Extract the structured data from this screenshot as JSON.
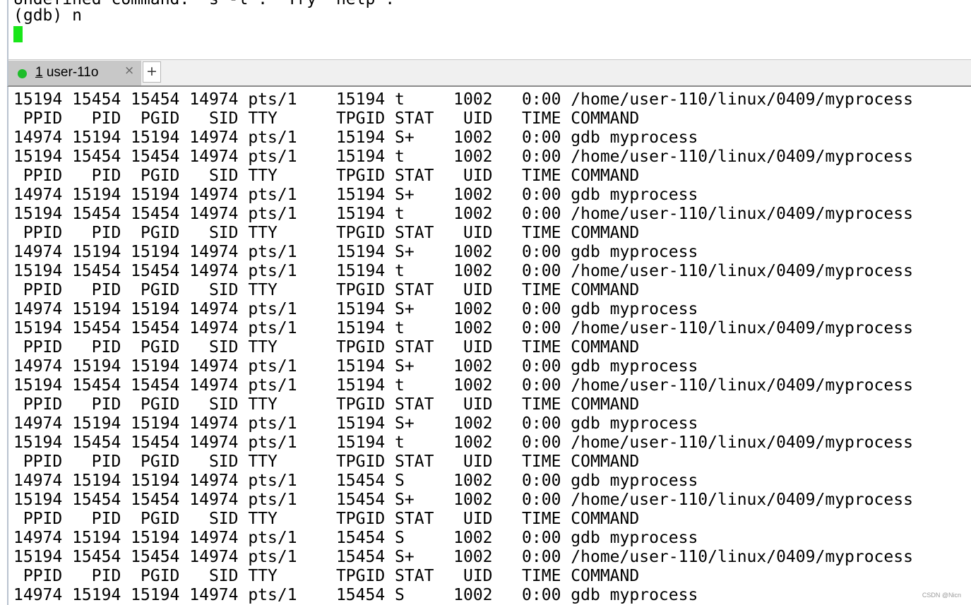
{
  "top_pane": {
    "lines": [
      "Undefined command: \"s -l\".  Try \"help\".",
      "(gdb) n"
    ]
  },
  "tab_bar": {
    "tab": {
      "index": "1",
      "title": " user-11o",
      "status_color": "#1ebd2a"
    },
    "close_glyph": "×",
    "new_tab_glyph": "+"
  },
  "output_lines": [
    "15194 15454 15454 14974 pts/1    15194 t     1002   0:00 /home/user-110/linux/0409/myprocess",
    " PPID   PID  PGID   SID TTY      TPGID STAT   UID   TIME COMMAND",
    "14974 15194 15194 14974 pts/1    15194 S+    1002   0:00 gdb myprocess",
    "15194 15454 15454 14974 pts/1    15194 t     1002   0:00 /home/user-110/linux/0409/myprocess",
    " PPID   PID  PGID   SID TTY      TPGID STAT   UID   TIME COMMAND",
    "14974 15194 15194 14974 pts/1    15194 S+    1002   0:00 gdb myprocess",
    "15194 15454 15454 14974 pts/1    15194 t     1002   0:00 /home/user-110/linux/0409/myprocess",
    " PPID   PID  PGID   SID TTY      TPGID STAT   UID   TIME COMMAND",
    "14974 15194 15194 14974 pts/1    15194 S+    1002   0:00 gdb myprocess",
    "15194 15454 15454 14974 pts/1    15194 t     1002   0:00 /home/user-110/linux/0409/myprocess",
    " PPID   PID  PGID   SID TTY      TPGID STAT   UID   TIME COMMAND",
    "14974 15194 15194 14974 pts/1    15194 S+    1002   0:00 gdb myprocess",
    "15194 15454 15454 14974 pts/1    15194 t     1002   0:00 /home/user-110/linux/0409/myprocess",
    " PPID   PID  PGID   SID TTY      TPGID STAT   UID   TIME COMMAND",
    "14974 15194 15194 14974 pts/1    15194 S+    1002   0:00 gdb myprocess",
    "15194 15454 15454 14974 pts/1    15194 t     1002   0:00 /home/user-110/linux/0409/myprocess",
    " PPID   PID  PGID   SID TTY      TPGID STAT   UID   TIME COMMAND",
    "14974 15194 15194 14974 pts/1    15194 S+    1002   0:00 gdb myprocess",
    "15194 15454 15454 14974 pts/1    15194 t     1002   0:00 /home/user-110/linux/0409/myprocess",
    " PPID   PID  PGID   SID TTY      TPGID STAT   UID   TIME COMMAND",
    "14974 15194 15194 14974 pts/1    15454 S     1002   0:00 gdb myprocess",
    "15194 15454 15454 14974 pts/1    15454 S+    1002   0:00 /home/user-110/linux/0409/myprocess",
    " PPID   PID  PGID   SID TTY      TPGID STAT   UID   TIME COMMAND",
    "14974 15194 15194 14974 pts/1    15454 S     1002   0:00 gdb myprocess",
    "15194 15454 15454 14974 pts/1    15454 S+    1002   0:00 /home/user-110/linux/0409/myprocess",
    " PPID   PID  PGID   SID TTY      TPGID STAT   UID   TIME COMMAND",
    "14974 15194 15194 14974 pts/1    15454 S     1002   0:00 gdb myprocess"
  ],
  "watermark": "CSDN @Nicn",
  "colors": {
    "cursor": "#19e619",
    "terminal_bg": "#ffffff",
    "terminal_fg": "#000000",
    "tab_active_bg": "#c8c8c8"
  }
}
